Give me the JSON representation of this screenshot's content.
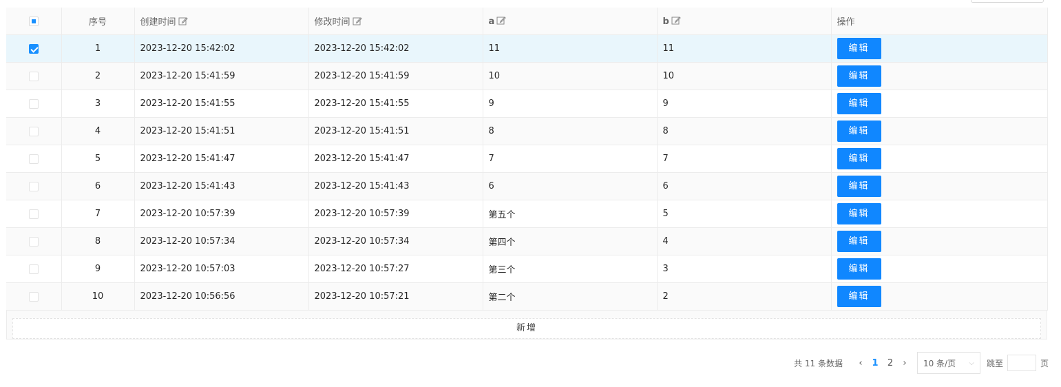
{
  "table": {
    "headers": {
      "index": "序号",
      "created": "创建时间",
      "modified": "修改时间",
      "a": "a",
      "b": "b",
      "actions": "操作"
    },
    "rows": [
      {
        "index": "1",
        "created": "2023-12-20 15:42:02",
        "modified": "2023-12-20 15:42:02",
        "a": "11",
        "b": "11",
        "checked": true
      },
      {
        "index": "2",
        "created": "2023-12-20 15:41:59",
        "modified": "2023-12-20 15:41:59",
        "a": "10",
        "b": "10",
        "checked": false
      },
      {
        "index": "3",
        "created": "2023-12-20 15:41:55",
        "modified": "2023-12-20 15:41:55",
        "a": "9",
        "b": "9",
        "checked": false
      },
      {
        "index": "4",
        "created": "2023-12-20 15:41:51",
        "modified": "2023-12-20 15:41:51",
        "a": "8",
        "b": "8",
        "checked": false
      },
      {
        "index": "5",
        "created": "2023-12-20 15:41:47",
        "modified": "2023-12-20 15:41:47",
        "a": "7",
        "b": "7",
        "checked": false
      },
      {
        "index": "6",
        "created": "2023-12-20 15:41:43",
        "modified": "2023-12-20 15:41:43",
        "a": "6",
        "b": "6",
        "checked": false
      },
      {
        "index": "7",
        "created": "2023-12-20 10:57:39",
        "modified": "2023-12-20 10:57:39",
        "a": "第五个",
        "b": "5",
        "checked": false
      },
      {
        "index": "8",
        "created": "2023-12-20 10:57:34",
        "modified": "2023-12-20 10:57:34",
        "a": "第四个",
        "b": "4",
        "checked": false
      },
      {
        "index": "9",
        "created": "2023-12-20 10:57:03",
        "modified": "2023-12-20 10:57:27",
        "a": "第三个",
        "b": "3",
        "checked": false
      },
      {
        "index": "10",
        "created": "2023-12-20 10:56:56",
        "modified": "2023-12-20 10:57:21",
        "a": "第二个",
        "b": "2",
        "checked": false
      }
    ],
    "edit_label": "编辑",
    "add_label": "新增"
  },
  "pagination": {
    "total_text": "共 11 条数据",
    "pages": [
      "1",
      "2"
    ],
    "current_page": "1",
    "page_size": "10 条/页",
    "jump_label": "跳至",
    "jump_suffix": "页"
  },
  "colors": {
    "primary": "#1087ff",
    "selected_row": "#e9f6fc"
  }
}
